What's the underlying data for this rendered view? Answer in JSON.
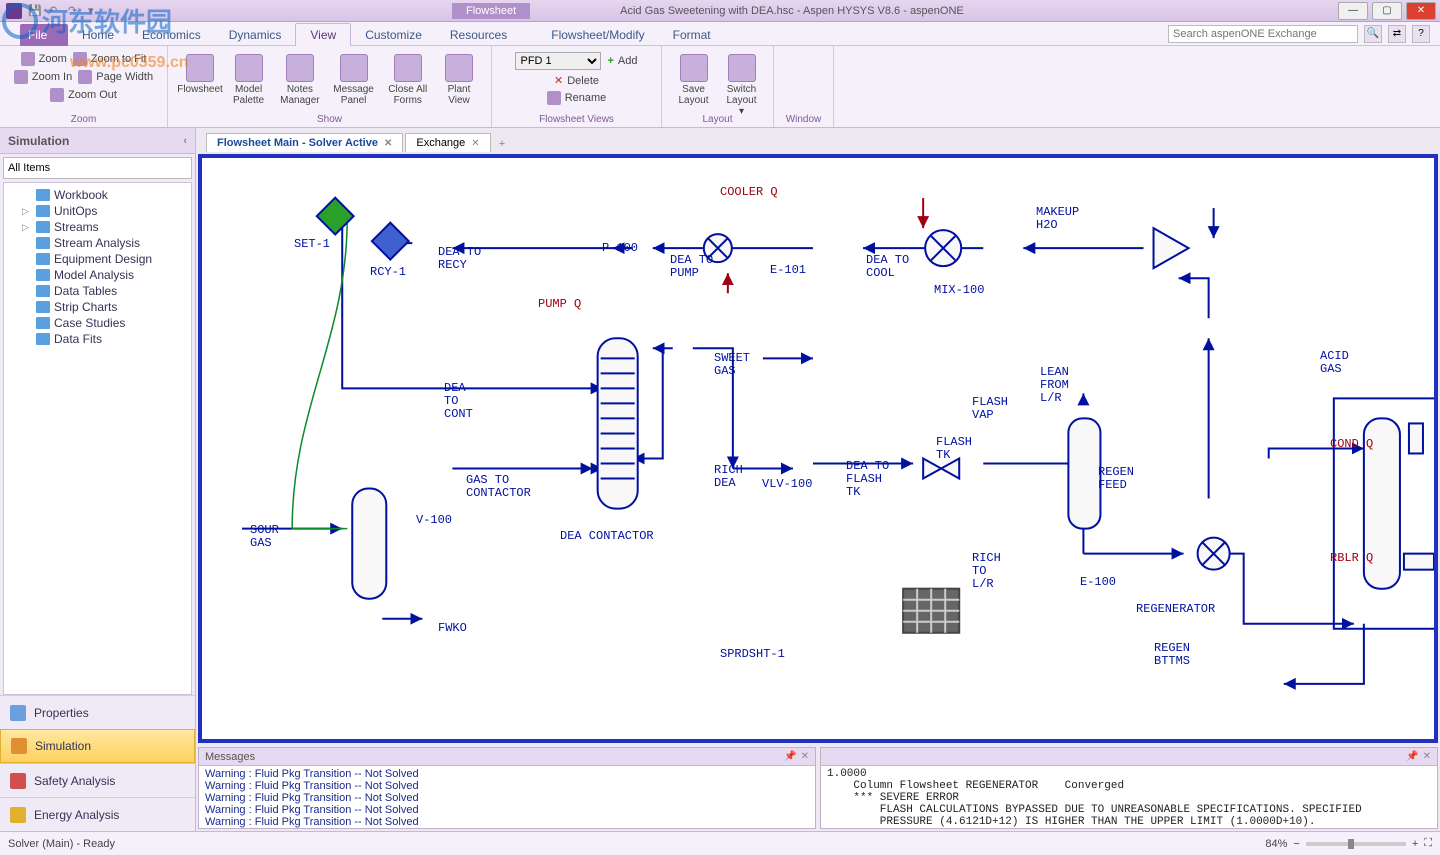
{
  "window": {
    "context_tab": "Flowsheet",
    "title": "Acid Gas Sweetening with DEA.hsc - Aspen HYSYS V8.6 - aspenONE",
    "search_placeholder": "Search aspenONE Exchange"
  },
  "ribbon_tabs": {
    "file": "File",
    "home": "Home",
    "economics": "Economics",
    "dynamics": "Dynamics",
    "view": "View",
    "customize": "Customize",
    "resources": "Resources",
    "flowsheet_modify": "Flowsheet/Modify",
    "format": "Format",
    "active": "View"
  },
  "ribbon": {
    "zoom": {
      "zoom": "Zoom",
      "zoom_in": "Zoom In",
      "zoom_out": "Zoom Out",
      "zoom_fit": "Zoom to Fit",
      "page_width": "Page Width",
      "group": "Zoom"
    },
    "show": {
      "flowsheet": "Flowsheet",
      "model_palette": "Model\nPalette",
      "notes_manager": "Notes\nManager",
      "message_panel": "Message\nPanel",
      "close_all_forms": "Close All\nForms",
      "plant_view": "Plant\nView",
      "group": "Show"
    },
    "fsv": {
      "pfd_selected": "PFD 1",
      "add": "Add",
      "delete": "Delete",
      "rename": "Rename",
      "group": "Flowsheet Views"
    },
    "layout": {
      "save_layout": "Save\nLayout",
      "switch_layout": "Switch\nLayout ▾",
      "group": "Layout"
    },
    "window": {
      "group": "Window"
    }
  },
  "sidebar": {
    "title": "Simulation",
    "filter": "All Items",
    "items": [
      "Workbook",
      "UnitOps",
      "Streams",
      "Stream Analysis",
      "Equipment Design",
      "Model Analysis",
      "Data Tables",
      "Strip Charts",
      "Case Studies",
      "Data Fits"
    ],
    "envs": {
      "properties": "Properties",
      "simulation": "Simulation",
      "safety": "Safety Analysis",
      "energy": "Energy Analysis"
    }
  },
  "doc_tabs": {
    "t0": "Flowsheet Main - Solver Active",
    "t1": "Exchange"
  },
  "flowsheet_labels": {
    "set1": "SET-1",
    "rcy1": "RCY-1",
    "dea_to_recy": "DEA TO\nRECY",
    "dea_to_cont": "DEA\nTO\nCONT",
    "pump_q": "PUMP Q",
    "p100": "P-100",
    "e101": "E-101",
    "cooler_q": "COOLER Q",
    "dea_to_pump": "DEA TO\nPUMP",
    "dea_to_cool": "DEA TO\nCOOL",
    "mix100": "MIX-100",
    "makeup_h2o": "MAKEUP\nH2O",
    "lean_from_lr": "LEAN\nFROM\nL/R",
    "sour_gas": "SOUR\nGAS",
    "v100": "V-100",
    "gas_to_contactor": "GAS TO\nCONTACTOR",
    "fwko": "FWKO",
    "dea_contactor": "DEA CONTACTOR",
    "sweet_gas": "SWEET\nGAS",
    "rich_dea": "RICH\nDEA",
    "vlv100": "VLV-100",
    "dea_to_flash": "DEA TO\nFLASH\nTK",
    "flash_tk": "FLASH\nTK",
    "flash_vap": "FLASH\nVAP",
    "rich_to_lr": "RICH\nTO\nL/R",
    "e100": "E-100",
    "regen_feed": "REGEN\nFEED",
    "regenerator": "REGENERATOR",
    "acid_gas": "ACID\nGAS",
    "cond_q": "COND Q",
    "rblr_q": "RBLR Q",
    "regen_bttms": "REGEN\nBTTMS",
    "sprdsht1": "SPRDSHT-1"
  },
  "messages": {
    "header": "Messages",
    "left": [
      "Warning  : Fluid Pkg Transition -- Not Solved",
      "Warning  : Fluid Pkg Transition -- Not Solved",
      "Warning  : Fluid Pkg Transition -- Not Solved",
      "Warning  : Fluid Pkg Transition -- Not Solved",
      "Warning  : Fluid Pkg Transition -- Not Solved"
    ],
    "right": "1.0000\n    Column Flowsheet REGENERATOR    Converged\n    *** SEVERE ERROR\n        FLASH CALCULATIONS BYPASSED DUE TO UNREASONABLE SPECIFICATIONS. SPECIFIED\n        PRESSURE (4.6121D+12) IS HIGHER THAN THE UPPER LIMIT (1.0000D+10)."
  },
  "status": {
    "left": "Solver (Main) - Ready",
    "zoom": "84%"
  },
  "watermark": {
    "brand": "河东软件园",
    "url": "www.pc0359.cn"
  }
}
